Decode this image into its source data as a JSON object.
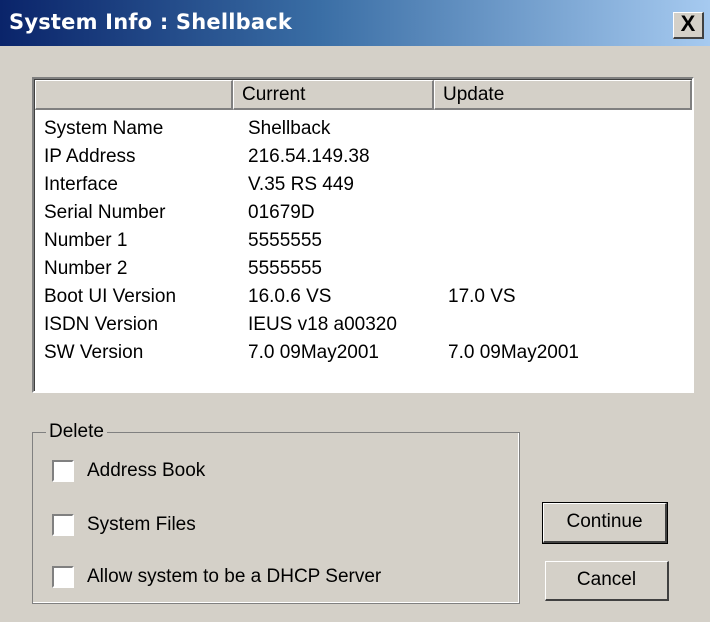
{
  "window": {
    "title": "System Info : Shellback",
    "close_label": "X"
  },
  "table": {
    "columns": [
      "",
      "Current",
      "Update"
    ],
    "rows": [
      {
        "name": "System Name",
        "current": "Shellback",
        "update": ""
      },
      {
        "name": "IP Address",
        "current": "216.54.149.38",
        "update": ""
      },
      {
        "name": "Interface",
        "current": "V.35 RS 449",
        "update": ""
      },
      {
        "name": "Serial Number",
        "current": "01679D",
        "update": ""
      },
      {
        "name": "Number 1",
        "current": "5555555",
        "update": ""
      },
      {
        "name": "Number 2",
        "current": "5555555",
        "update": ""
      },
      {
        "name": "Boot UI Version",
        "current": "16.0.6 VS",
        "update": "17.0 VS"
      },
      {
        "name": "ISDN Version",
        "current": "IEUS v18 a00320",
        "update": ""
      },
      {
        "name": "SW Version",
        "current": "7.0 09May2001",
        "update": "7.0 09May2001"
      }
    ]
  },
  "delete_group": {
    "legend": "Delete",
    "options": [
      {
        "label": "Address Book",
        "checked": false
      },
      {
        "label": "System Files",
        "checked": false
      },
      {
        "label": "Allow system to be a DHCP Server",
        "checked": false
      }
    ]
  },
  "buttons": {
    "continue": "Continue",
    "cancel": "Cancel"
  }
}
